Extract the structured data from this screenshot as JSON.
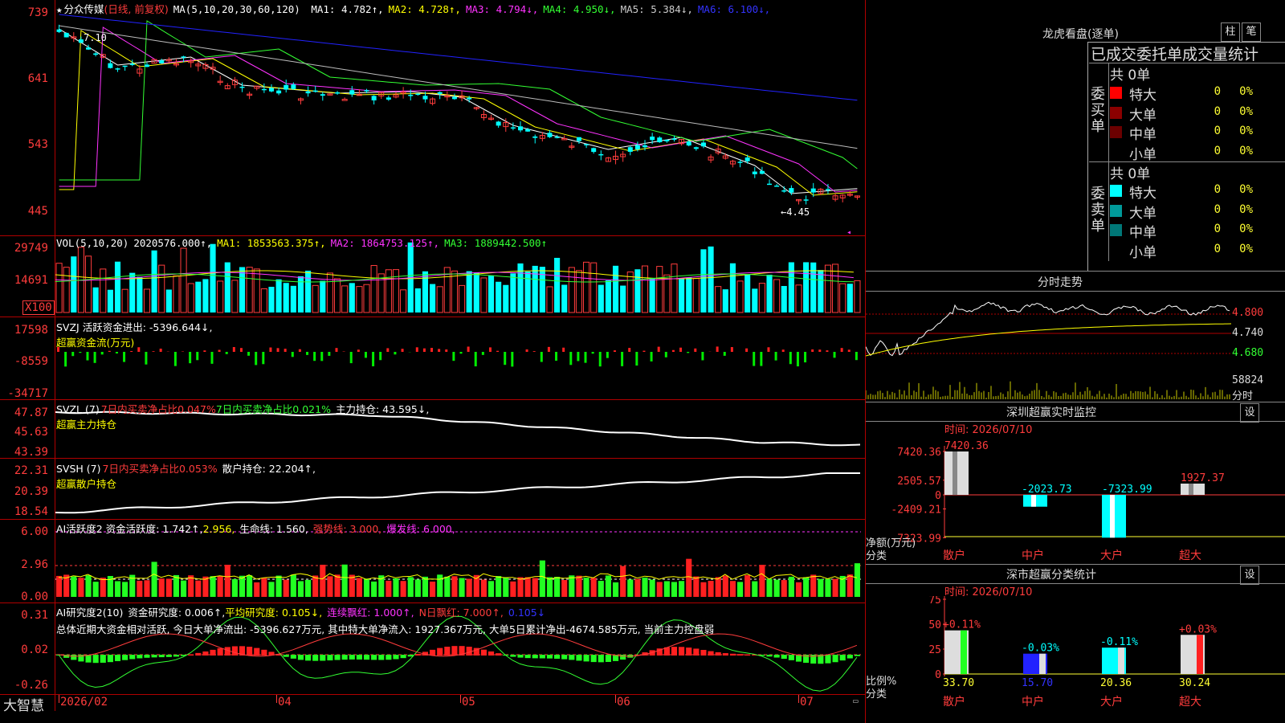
{
  "main_chart": {
    "title_star": "★",
    "stock_name": "分众传媒",
    "period": "(日线, 前复权)",
    "ma_label": "MA(5,10,20,30,60,120)",
    "ma_items": [
      {
        "label": "MA1:",
        "value": "4.782",
        "arrow": "↑",
        "color": "#ffffff"
      },
      {
        "label": "MA2:",
        "value": "4.728",
        "arrow": "↑",
        "color": "#ffff00"
      },
      {
        "label": "MA3:",
        "value": "4.794",
        "arrow": "↓",
        "color": "#ff33ff"
      },
      {
        "label": "MA4:",
        "value": "4.950",
        "arrow": "↓",
        "color": "#33ff33"
      },
      {
        "label": "MA5:",
        "value": "5.384",
        "arrow": "↓",
        "color": "#cccccc"
      },
      {
        "label": "MA6:",
        "value": "6.100",
        "arrow": "↓",
        "color": "#3333ff"
      }
    ],
    "y_ticks": [
      "739",
      "641",
      "543",
      "445"
    ],
    "annot_high": "7.10",
    "annot_low": "←4.45"
  },
  "vol_panel": {
    "legend": [
      "VOL(5,10,20)",
      "2020576.000↑,",
      "MA1: 1853563.375↑,",
      "MA2: 1864753.125↑,",
      "MA3: 1889442.500↑"
    ],
    "y_ticks": [
      "29749",
      "14691"
    ],
    "unit": "X100"
  },
  "svzj_panel": {
    "legend": "SVZJ  活跃资金进出: -5396.644↓,",
    "legend2": "超赢资金流(万元)",
    "y_ticks": [
      "17598",
      "-8559",
      "-34717"
    ]
  },
  "svzl_panel": {
    "legend_a": "SVZL (7)",
    "legend_b": "7日内买卖净占比0.047%",
    "legend_c": "7日内买卖净占比0.021%",
    "legend_d": "主力持仓: 43.595↓,",
    "legend2": "超赢主力持仓",
    "y_ticks": [
      "47.87",
      "45.63",
      "43.39"
    ]
  },
  "svsh_panel": {
    "legend_a": "SVSH (7)",
    "legend_b": "7日内买卖净占比0.053%",
    "legend_c": "散户持仓: 22.204↑,",
    "legend2": "超赢散户持仓",
    "y_ticks": [
      "22.31",
      "20.39",
      "18.54"
    ]
  },
  "ai_active_panel": {
    "legend_a": "AI活跃度2 资金活跃度: 1.742↑,",
    "legend_b": "2.956,",
    "legend_c": "生命线: 1.560,",
    "legend_d": "强势线: 3.000,",
    "legend_e": "爆发线: 6.000,",
    "y_ticks": [
      "6.00",
      "2.96",
      "0.00"
    ]
  },
  "ai_research_panel": {
    "legend_a": "AI研究度2(10)",
    "legend_b": "资金研究度: 0.006↑,",
    "legend_c": "平均研究度: 0.105↓,",
    "legend_d": "连续飘红: 1.000↑,",
    "legend_e": "N日飘红: 7.000↑,",
    "legend_f": "0.105↓",
    "summary": "总体近期大资金相对活跃, 今日大单净流出: -5396.627万元, 其中特大单净流入: 1927.367万元, 大单5日累计净出-4674.585万元, 当前主力控盘弱",
    "y_ticks": [
      "0.31",
      "0.02",
      "-0.26"
    ]
  },
  "x_axis": {
    "brand": "大智慧",
    "labels": [
      "2026/02",
      "04",
      "05",
      "06",
      "07"
    ]
  },
  "right_top": {
    "title": "龙虎看盘(逐单)",
    "btn1": "柱",
    "btn2": "笔",
    "header": "已成交委托单成交量统计",
    "buy_label": "委买单",
    "sell_label": "委卖单",
    "buy_total": "共 0单",
    "sell_total": "共 0单",
    "buy_rows": [
      {
        "name": "特大",
        "count": "0",
        "pct": "0%",
        "color": "#ff0000"
      },
      {
        "name": "大单",
        "count": "0",
        "pct": "0%",
        "color": "#8b0000"
      },
      {
        "name": "中单",
        "count": "0",
        "pct": "0%",
        "color": "#6b0000"
      },
      {
        "name": "小单",
        "count": "0",
        "pct": "0%",
        "color": "#000000"
      }
    ],
    "sell_rows": [
      {
        "name": "特大",
        "count": "0",
        "pct": "0%",
        "color": "#00ffff"
      },
      {
        "name": "大单",
        "count": "0",
        "pct": "0%",
        "color": "#009999"
      },
      {
        "name": "中单",
        "count": "0",
        "pct": "0%",
        "color": "#007777"
      },
      {
        "name": "小单",
        "count": "0",
        "pct": "0%",
        "color": "#000000"
      }
    ]
  },
  "intraday": {
    "title": "分时走势",
    "y_ticks": [
      "4.800",
      "4.740",
      "4.680"
    ],
    "vol_tick": "58824",
    "vol_label": "分时"
  },
  "sz_monitor": {
    "title": "深圳超赢实时监控",
    "btn": "设",
    "time": "时间: 2026/07/10",
    "y_ticks": [
      "7420.36",
      "2505.57",
      "0",
      "-2409.21",
      "-7323.99"
    ],
    "y_title": "净额(万元)",
    "x_title": "分类",
    "categories": [
      "散户",
      "中户",
      "大户",
      "超大"
    ],
    "values": [
      7420.36,
      -2023.73,
      -7323.99,
      1927.37
    ],
    "value_labels": [
      "7420.36",
      "-2023.73",
      "-7323.99",
      "1927.37"
    ]
  },
  "sz_category": {
    "title": "深市超赢分类统计",
    "btn": "设",
    "time": "时间: 2026/07/10",
    "y_ticks": [
      "75",
      "50",
      "25",
      "0"
    ],
    "y_title": "比例%",
    "x_title": "分类",
    "categories": [
      "散户",
      "中户",
      "大户",
      "超大"
    ],
    "values": [
      33.7,
      15.7,
      20.36,
      30.24
    ],
    "value_labels": [
      "33.70",
      "15.70",
      "20.36",
      "30.24"
    ],
    "change_labels": [
      "+0.11%",
      "-0.03%",
      "-0.11%",
      "+0.03%"
    ]
  }
}
